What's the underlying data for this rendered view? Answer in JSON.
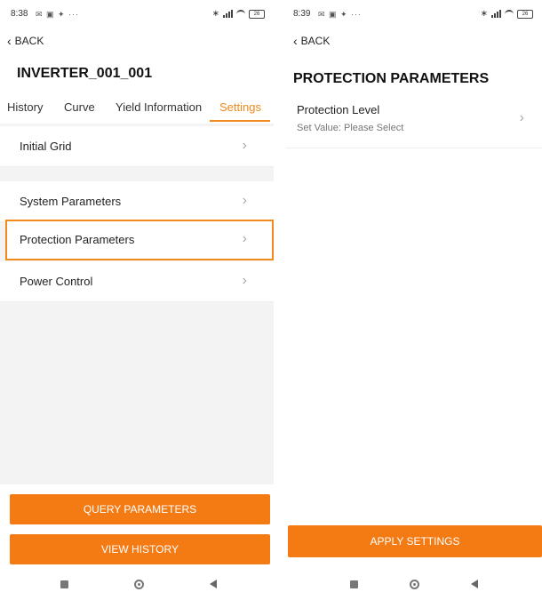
{
  "left": {
    "status": {
      "time": "8:38",
      "icons": "✉ ▣ ✦  ···",
      "battery": "26"
    },
    "back_label": "BACK",
    "device_title": "INVERTER_001_001",
    "tabs": [
      {
        "label": "History"
      },
      {
        "label": "Curve"
      },
      {
        "label": "Yield Information"
      },
      {
        "label": "Settings",
        "active": true
      }
    ],
    "menu": [
      {
        "label": "Initial Grid"
      },
      {
        "label": "System Parameters"
      },
      {
        "label": "Protection Parameters",
        "highlighted": true
      },
      {
        "label": "Power Control"
      }
    ],
    "buttons": {
      "query": "QUERY PARAMETERS",
      "history": "VIEW HISTORY"
    }
  },
  "right": {
    "status": {
      "time": "8:39",
      "icons": "✉ ▣ ✦  ···",
      "battery": "26"
    },
    "back_label": "BACK",
    "page_title": "PROTECTION PARAMETERS",
    "protection_level": {
      "label": "Protection Level",
      "value": "Set Value: Please Select"
    },
    "apply_label": "APPLY SETTINGS"
  },
  "colors": {
    "accent": "#f47a14",
    "tab_active": "#f08a1c",
    "highlight_border": "#f08a1c",
    "gray_bg": "#f3f3f3"
  },
  "icons": [
    "bluetooth-icon",
    "signal-icon",
    "wifi-icon",
    "battery-icon",
    "chevron-left-icon",
    "chevron-right-icon",
    "nav-recent-icon",
    "nav-home-icon",
    "nav-back-icon"
  ]
}
